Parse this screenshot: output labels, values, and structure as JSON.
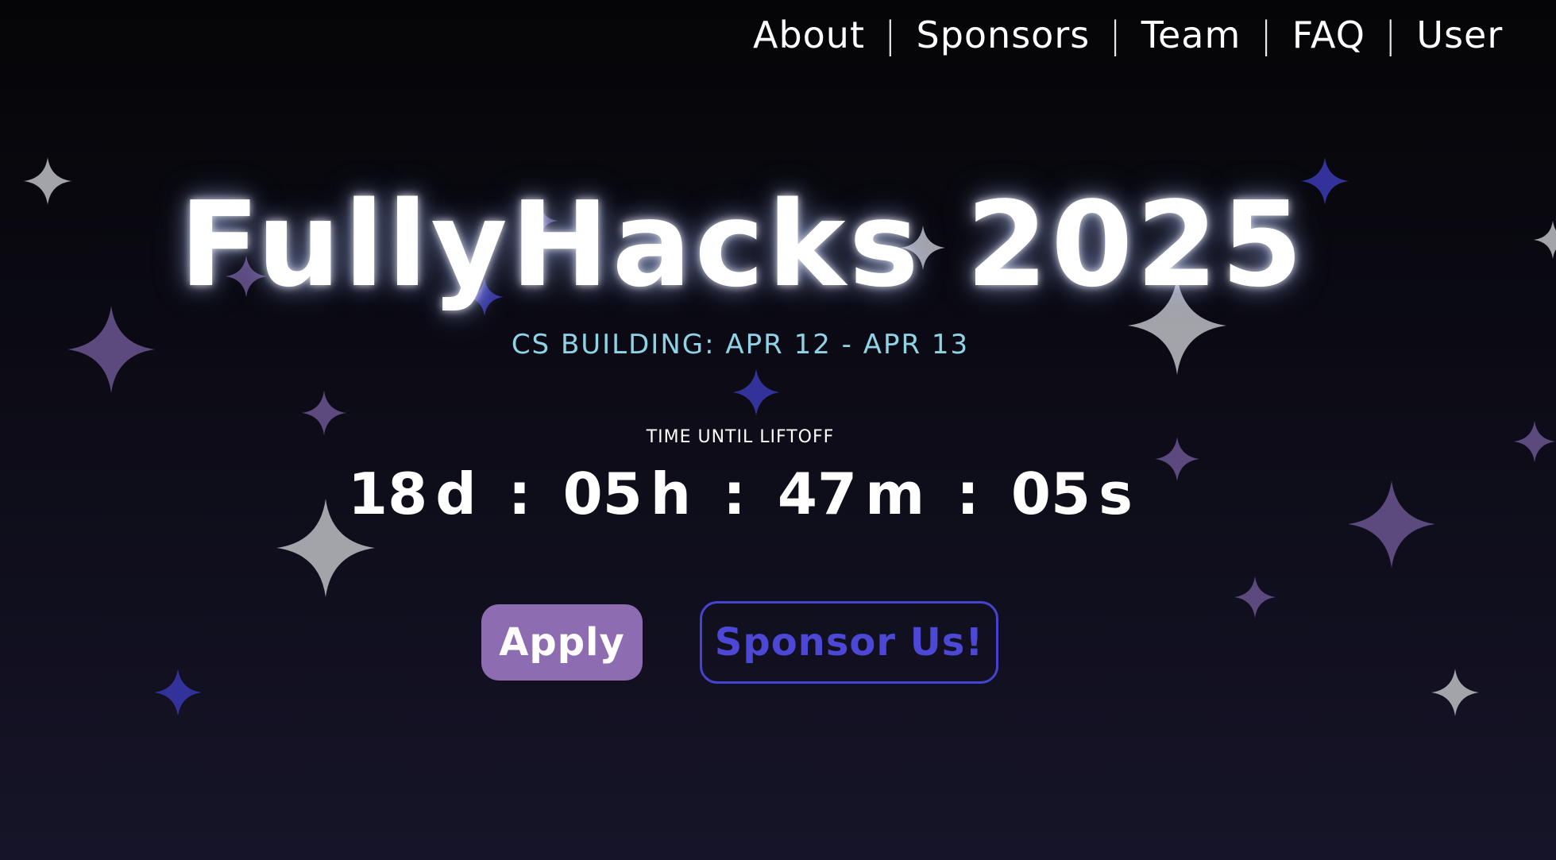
{
  "nav": {
    "items": [
      {
        "label": "About"
      },
      {
        "label": "Sponsors"
      },
      {
        "label": "Team"
      },
      {
        "label": "FAQ"
      },
      {
        "label": "User"
      }
    ],
    "separator": "|"
  },
  "hero": {
    "title": "FullyHacks 2025",
    "subtitle": "CS BUILDING: APR 12 - APR 13",
    "countdown_label": "TIME UNTIL LIFTOFF",
    "countdown": {
      "days": "18",
      "days_unit": "d",
      "hours": "05",
      "hours_unit": "h",
      "minutes": "47",
      "minutes_unit": "m",
      "seconds": "05",
      "seconds_unit": "s",
      "separator": ":"
    }
  },
  "buttons": {
    "apply": "Apply",
    "sponsor": "Sponsor Us!"
  },
  "colors": {
    "background_top": "#050507",
    "background_bottom": "#161428",
    "subtitle": "#8fd3e6",
    "apply_bg": "#8e6cb2",
    "sponsor_border": "#4743d1",
    "star_purple": "#5c4a7e",
    "star_gray": "#a3a3aa",
    "star_blue": "#33329a"
  },
  "decorations": {
    "stars": "sparkle-star-icon"
  }
}
